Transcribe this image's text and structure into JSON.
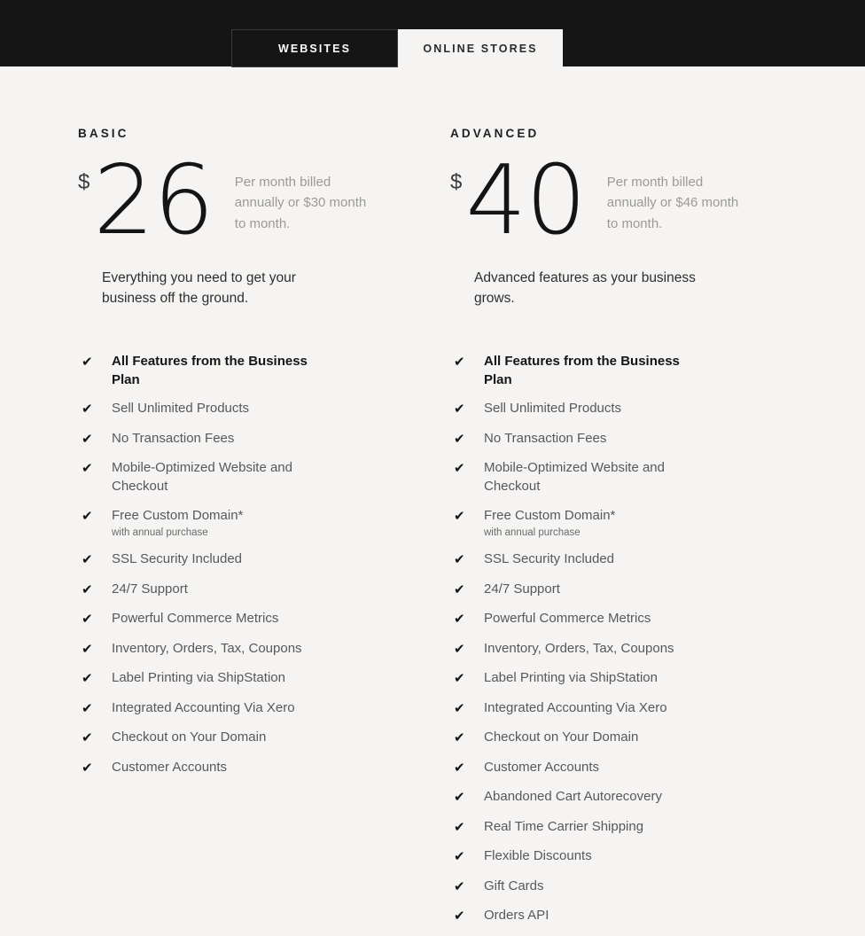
{
  "header": {
    "tabs": [
      {
        "label": "WEBSITES",
        "active": false
      },
      {
        "label": "ONLINE STORES",
        "active": true
      }
    ],
    "background_color": "#151515"
  },
  "colors": {
    "page_background": "#f5f4f2",
    "header_background": "#151515",
    "price_text": "#141414",
    "muted_text": "#9c9a97",
    "feature_text": "#58585a"
  },
  "icons": {
    "check": "✔"
  },
  "plans": [
    {
      "name": "BASIC",
      "currency": "$",
      "amount": "26",
      "price_note": "Per month billed annually or $30 month to month.",
      "tagline": "Everything you need to get your business off the ground.",
      "features": [
        {
          "label": "All Features from the Business Plan",
          "emphasis": true,
          "sub": ""
        },
        {
          "label": "Sell Unlimited Products",
          "emphasis": false,
          "sub": ""
        },
        {
          "label": "No Transaction Fees",
          "emphasis": false,
          "sub": ""
        },
        {
          "label": "Mobile-Optimized Website and Checkout",
          "emphasis": false,
          "sub": ""
        },
        {
          "label": "Free Custom Domain*",
          "emphasis": false,
          "sub": "with annual purchase"
        },
        {
          "label": "SSL Security Included",
          "emphasis": false,
          "sub": ""
        },
        {
          "label": "24/7 Support",
          "emphasis": false,
          "sub": ""
        },
        {
          "label": "Powerful Commerce Metrics",
          "emphasis": false,
          "sub": ""
        },
        {
          "label": "Inventory, Orders, Tax, Coupons",
          "emphasis": false,
          "sub": ""
        },
        {
          "label": "Label Printing via ShipStation",
          "emphasis": false,
          "sub": ""
        },
        {
          "label": "Integrated Accounting Via Xero",
          "emphasis": false,
          "sub": ""
        },
        {
          "label": "Checkout on Your Domain",
          "emphasis": false,
          "sub": ""
        },
        {
          "label": "Customer Accounts",
          "emphasis": false,
          "sub": ""
        }
      ]
    },
    {
      "name": "ADVANCED",
      "currency": "$",
      "amount": "40",
      "price_note": "Per month billed annually or $46 month to month.",
      "tagline": "Advanced features as your business grows.",
      "features": [
        {
          "label": "All Features from the Business Plan",
          "emphasis": true,
          "sub": ""
        },
        {
          "label": "Sell Unlimited Products",
          "emphasis": false,
          "sub": ""
        },
        {
          "label": "No Transaction Fees",
          "emphasis": false,
          "sub": ""
        },
        {
          "label": "Mobile-Optimized Website and Checkout",
          "emphasis": false,
          "sub": ""
        },
        {
          "label": "Free Custom Domain*",
          "emphasis": false,
          "sub": "with annual purchase"
        },
        {
          "label": "SSL Security Included",
          "emphasis": false,
          "sub": ""
        },
        {
          "label": "24/7 Support",
          "emphasis": false,
          "sub": ""
        },
        {
          "label": "Powerful Commerce Metrics",
          "emphasis": false,
          "sub": ""
        },
        {
          "label": "Inventory, Orders, Tax, Coupons",
          "emphasis": false,
          "sub": ""
        },
        {
          "label": "Label Printing via ShipStation",
          "emphasis": false,
          "sub": ""
        },
        {
          "label": "Integrated Accounting Via Xero",
          "emphasis": false,
          "sub": ""
        },
        {
          "label": "Checkout on Your Domain",
          "emphasis": false,
          "sub": ""
        },
        {
          "label": "Customer Accounts",
          "emphasis": false,
          "sub": ""
        },
        {
          "label": "Abandoned Cart Autorecovery",
          "emphasis": false,
          "sub": ""
        },
        {
          "label": "Real Time Carrier Shipping",
          "emphasis": false,
          "sub": ""
        },
        {
          "label": "Flexible Discounts",
          "emphasis": false,
          "sub": ""
        },
        {
          "label": "Gift Cards",
          "emphasis": false,
          "sub": ""
        },
        {
          "label": "Orders API",
          "emphasis": false,
          "sub": ""
        }
      ]
    }
  ]
}
